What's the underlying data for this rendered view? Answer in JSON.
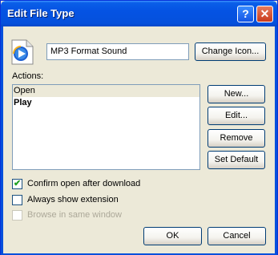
{
  "window": {
    "title": "Edit File Type",
    "help_glyph": "?",
    "close_glyph": "✕"
  },
  "file_type": {
    "icon": "media-player-icon",
    "description": "MP3 Format Sound",
    "change_icon_label": "Change Icon..."
  },
  "actions": {
    "label": "Actions:",
    "items": [
      {
        "label": "Open",
        "selected": true,
        "default": false
      },
      {
        "label": "Play",
        "selected": false,
        "default": true
      }
    ],
    "new_label": "New...",
    "edit_label": "Edit...",
    "remove_label": "Remove",
    "set_default_label": "Set Default"
  },
  "options": {
    "confirm_open": {
      "label": "Confirm open after download",
      "checked": true,
      "enabled": true
    },
    "always_show_extension": {
      "label": "Always show extension",
      "checked": false,
      "enabled": true
    },
    "browse_same_window": {
      "label": "Browse in same window",
      "checked": false,
      "enabled": false
    }
  },
  "footer": {
    "ok_label": "OK",
    "cancel_label": "Cancel"
  },
  "colors": {
    "titlebar": "#0550dc",
    "dialog_bg": "#ece9d8",
    "check": "#21a121"
  }
}
